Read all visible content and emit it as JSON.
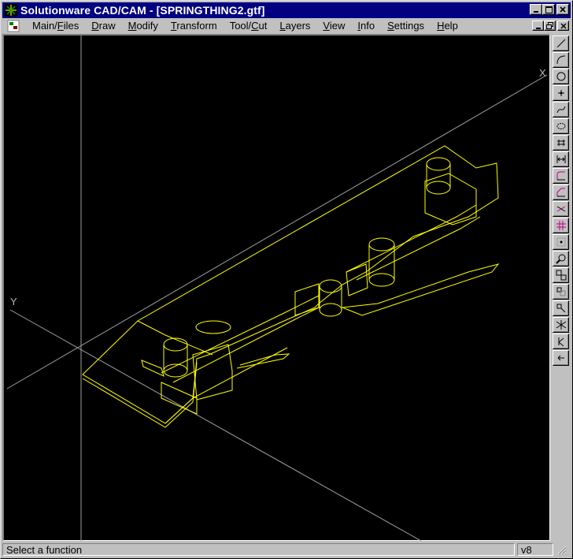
{
  "window": {
    "title": "Solutionware CAD/CAM - [SPRINGTHING2.gtf]",
    "caption_buttons": [
      "minimize-icon",
      "maximize-icon",
      "close-icon"
    ]
  },
  "menubar": {
    "items": [
      {
        "label": "Main/Files",
        "mnemonic": "F"
      },
      {
        "label": "Draw",
        "mnemonic": "D"
      },
      {
        "label": "Modify",
        "mnemonic": "M"
      },
      {
        "label": "Transform",
        "mnemonic": "T"
      },
      {
        "label": "Tool/Cut",
        "mnemonic": "C"
      },
      {
        "label": "Layers",
        "mnemonic": "L"
      },
      {
        "label": "View",
        "mnemonic": "V"
      },
      {
        "label": "Info",
        "mnemonic": "I"
      },
      {
        "label": "Settings",
        "mnemonic": "S"
      },
      {
        "label": "Help",
        "mnemonic": "H"
      }
    ],
    "mdi_buttons": [
      "restore-child-icon",
      "maximize-child-icon",
      "close-child-icon"
    ]
  },
  "viewport": {
    "x_axis_label": "X",
    "y_axis_label": "Y",
    "background": "#000000",
    "geometry_color": "#ffff00",
    "axis_color": "#a0a0a0"
  },
  "toolbar": {
    "tools": [
      "line-icon",
      "arc-icon",
      "circle-icon",
      "point-icon",
      "spline-icon",
      "ellipse-icon",
      "text-icon",
      "dimension-icon",
      "fillet-icon",
      "chamfer-icon",
      "trim-icon",
      "grid-icon",
      "snap-point-icon",
      "zoom-icon",
      "zoom-window-icon",
      "zoom-out-icon",
      "zoom-prev-icon",
      "isometric-view-icon",
      "rotate-view-icon",
      "redraw-icon"
    ]
  },
  "statusbar": {
    "message": "Select a function",
    "version": "v8"
  }
}
